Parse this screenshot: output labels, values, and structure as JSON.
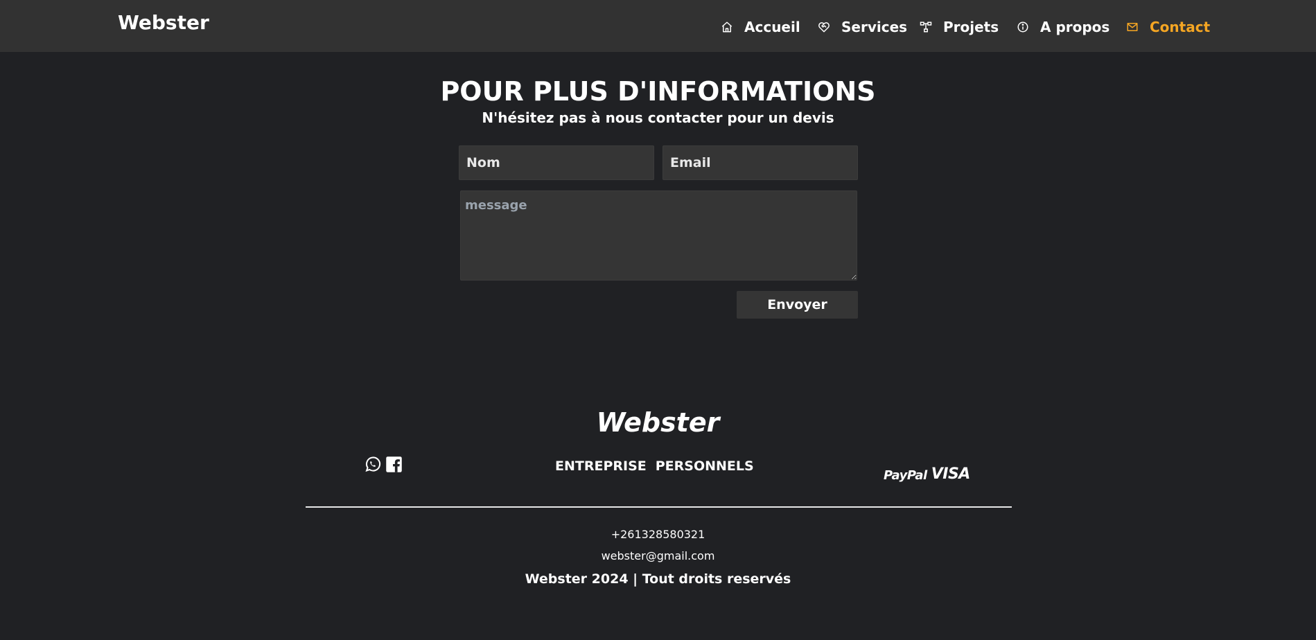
{
  "nav": {
    "brand": "Webster",
    "items": [
      {
        "label": "Accueil",
        "icon": "home-icon"
      },
      {
        "label": "Services",
        "icon": "heart-handshake-icon"
      },
      {
        "label": "Projets",
        "icon": "hierarchy-icon"
      },
      {
        "label": "A propos",
        "icon": "info-icon"
      },
      {
        "label": "Contact",
        "icon": "mail-icon",
        "active": true
      }
    ],
    "active_color": "#f5a623"
  },
  "contact": {
    "title": "POUR PLUS D'INFORMATIONS",
    "subtitle": "N'hésitez pas à nous contacter pour un devis",
    "name_placeholder": "Nom",
    "email_placeholder": "Email",
    "message_placeholder": "message",
    "submit_label": "Envoyer"
  },
  "footer": {
    "logo": "Webster",
    "social": [
      "whatsapp-icon",
      "facebook-icon"
    ],
    "links": [
      "ENTREPRISE",
      "PERSONNELS"
    ],
    "payments": [
      "PayPal",
      "VISA"
    ],
    "phone": "+261328580321",
    "email": "webster@gmail.com",
    "copyright": "Webster 2024 | Tout droits reservés"
  },
  "colors": {
    "background": "#202124",
    "navbar": "#323232",
    "input": "#353535",
    "accent": "#f5a623"
  }
}
